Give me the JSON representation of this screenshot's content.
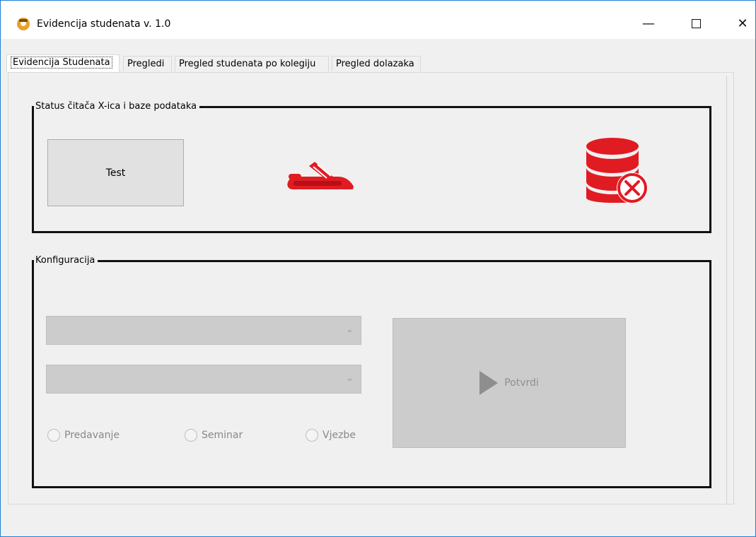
{
  "window": {
    "title": "Evidencija studenata v. 1.0",
    "controls": {
      "minimize_label": "—",
      "maximize_label": "",
      "close_label": "✕"
    }
  },
  "tabs": [
    {
      "label": "Evidencija Studenata",
      "active": true
    },
    {
      "label": "Pregledi",
      "active": false
    },
    {
      "label": "Pregled studenata po kolegiju",
      "active": false
    },
    {
      "label": "Pregled dolazaka",
      "active": false
    }
  ],
  "status_group": {
    "title": "Status čitača X-ica i baze podataka",
    "test_button": "Test",
    "reader_icon": "card-reader-icon",
    "database_icon": "database-error-icon",
    "accent_color": "#e11b22"
  },
  "config_group": {
    "title": "Konfiguracija",
    "combo1_value": "",
    "combo2_value": "",
    "radio_options": [
      "Predavanje",
      "Seminar",
      "Vjezbe"
    ],
    "confirm_button": "Potvrdi",
    "confirm_icon": "play-icon"
  }
}
